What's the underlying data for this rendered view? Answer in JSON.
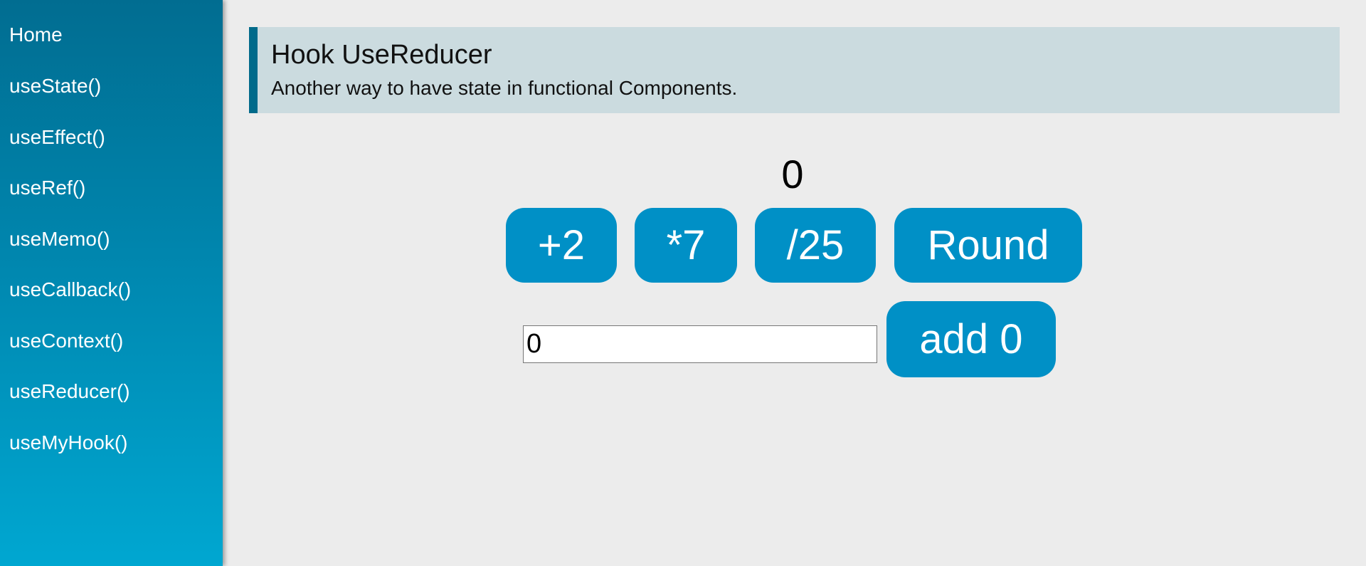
{
  "sidebar": {
    "items": [
      {
        "label": "Home"
      },
      {
        "label": "useState()"
      },
      {
        "label": "useEffect()"
      },
      {
        "label": "useRef()"
      },
      {
        "label": "useMemo()"
      },
      {
        "label": "useCallback()"
      },
      {
        "label": "useContext()"
      },
      {
        "label": "useReducer()"
      },
      {
        "label": "useMyHook()"
      }
    ]
  },
  "header": {
    "title": "Hook UseReducer",
    "subtitle": "Another way to have state in functional Components."
  },
  "counter": {
    "value": "0"
  },
  "actions": {
    "add_two": "+2",
    "multiply_seven": "*7",
    "divide_twentyfive": "/25",
    "round": "Round"
  },
  "add_form": {
    "input_value": "0",
    "add_button": "add 0"
  },
  "colors": {
    "sidebar_top": "#016d91",
    "sidebar_bottom": "#00a7d1",
    "button": "#0090c6",
    "header_bg": "#cbdbdf",
    "header_accent": "#006a8a",
    "page_bg": "#ececec"
  }
}
